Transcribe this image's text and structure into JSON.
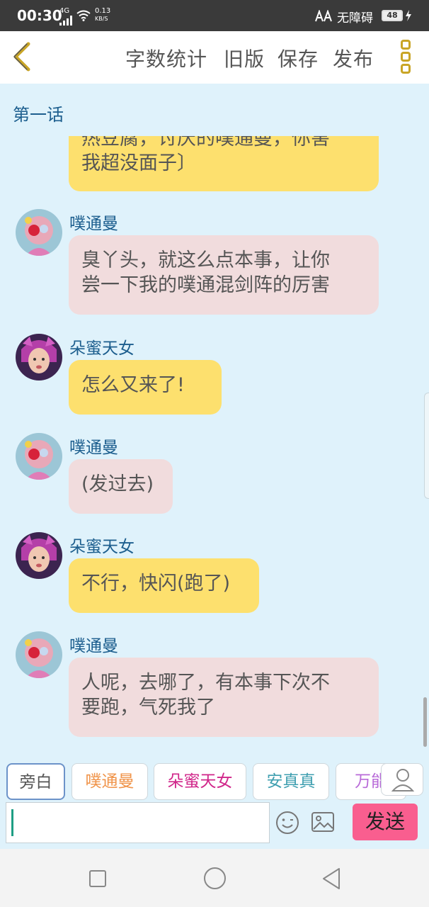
{
  "status_bar": {
    "time": "00:30",
    "network": "4G",
    "speed_value": "0.13",
    "speed_unit": "KB/S",
    "accessibility": "无障碍",
    "battery": "48"
  },
  "toolbar": {
    "stats": "字数统计",
    "old_version": "旧版",
    "save": "保存",
    "publish": "发布"
  },
  "chat": {
    "episode_title": "第一话",
    "messages": [
      {
        "speaker": "",
        "line1": "热豆腐，讨厌的噗通曼，你害",
        "line2": "我超没面子〕",
        "style": "yellow"
      },
      {
        "speaker": "噗通曼",
        "line1": "臭丫头，就这么点本事，让你",
        "line2": "尝一下我的噗通混剑阵的厉害",
        "style": "pink"
      },
      {
        "speaker": "朵蜜天女",
        "line1": "怎么又来了!",
        "line2": "",
        "style": "yellow"
      },
      {
        "speaker": "噗通曼",
        "line1": "(发过去)",
        "line2": "",
        "style": "pink"
      },
      {
        "speaker": "朵蜜天女",
        "line1": "不行，快闪(跑了)",
        "line2": "",
        "style": "yellow"
      },
      {
        "speaker": "噗通曼",
        "line1": "人呢，去哪了，有本事下次不",
        "line2": "要跑，气死我了",
        "style": "pink"
      }
    ]
  },
  "characters": [
    {
      "label": "旁白",
      "color": "#555555"
    },
    {
      "label": "噗通曼",
      "color": "#f0944a"
    },
    {
      "label": "朵蜜天女",
      "color": "#d0268a"
    },
    {
      "label": "安真真",
      "color": "#3f9fb0"
    },
    {
      "label": "万能",
      "color": "#b86ad8"
    }
  ],
  "input": {
    "value": "",
    "send": "发送"
  },
  "colors": {
    "chat_background": "#dff2fb",
    "yellow_bubble": "#fde06e",
    "pink_bubble": "#f1dcdd",
    "speaker_name": "#1c5e8e",
    "send_button": "#f95e8f",
    "back_arrow": "#c9a526"
  },
  "icons": {
    "back": "chevron-left-icon",
    "more": "more-vertical-icon",
    "emoji": "smiley-icon",
    "image": "image-icon",
    "user": "user-icon"
  }
}
